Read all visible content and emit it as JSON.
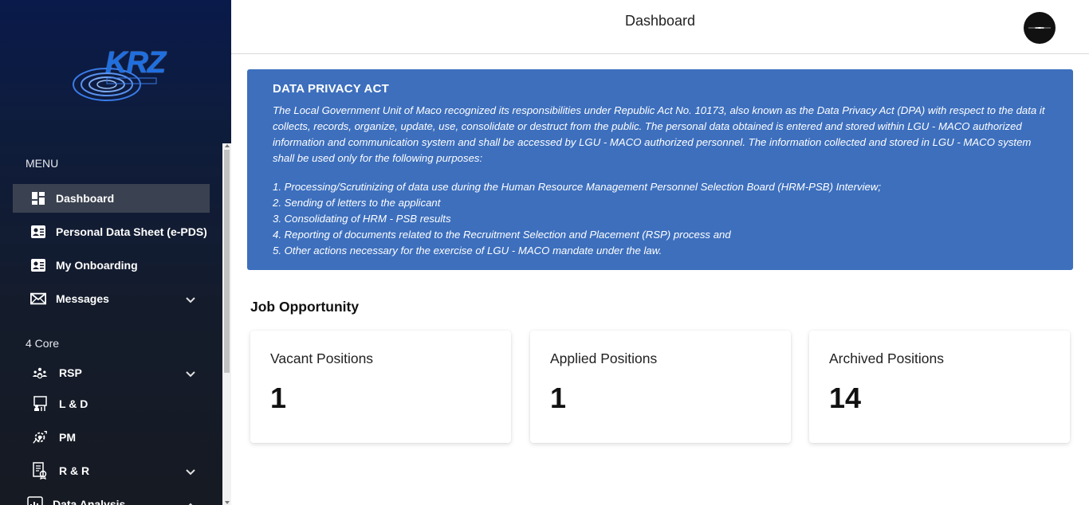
{
  "sidebar": {
    "logo_text": "KRZ",
    "menu_label": "MENU",
    "menu": [
      {
        "label": "Dashboard",
        "icon": "dashboard-grid-icon"
      },
      {
        "label": "Personal Data Sheet (e-PDS)",
        "icon": "id-card-icon"
      },
      {
        "label": "My Onboarding",
        "icon": "id-card-icon"
      },
      {
        "label": "Messages",
        "icon": "envelope-icon"
      }
    ],
    "core_label": "4 Core",
    "core": [
      {
        "label": "RSP",
        "icon": "people-network-icon"
      },
      {
        "label": "L & D",
        "icon": "training-board-icon"
      },
      {
        "label": "PM",
        "icon": "performance-gear-icon"
      },
      {
        "label": "R & R",
        "icon": "award-document-icon"
      },
      {
        "label": "Data Analysis",
        "icon": "chart-icon"
      }
    ]
  },
  "header": {
    "title": "Dashboard"
  },
  "privacy": {
    "title": "DATA PRIVACY ACT",
    "body": "The Local Government Unit of Maco recognized its responsibilities under Republic Act No. 10173, also known as the Data Privacy Act (DPA) with respect to the data it collects, records, organize, update, use, consolidate or destruct from the public. The personal data obtained is entered and stored within LGU - MACO authorized information and communication system and shall be accessed by LGU - MACO authorized personnel. The information collected and stored in LGU - MACO system shall be used only for the following purposes:",
    "items": [
      "1. Processing/Scrutinizing of data use during the Human Resource Management Personnel Selection Board (HRM-PSB) Interview;",
      "2. Sending of letters to the applicant",
      "3. Consolidating of HRM - PSB results",
      "4. Reporting of documents related to the Recruitment Selection and Placement (RSP) process and",
      "5. Other actions necessary for the exercise of LGU - MACO mandate under the law."
    ]
  },
  "jobs": {
    "title": "Job Opportunity",
    "cards": [
      {
        "label": "Vacant Positions",
        "value": "1"
      },
      {
        "label": "Applied Positions",
        "value": "1"
      },
      {
        "label": "Archived Positions",
        "value": "14"
      }
    ]
  },
  "colors": {
    "sidebar_top": "#0a1a4a",
    "sidebar_bottom": "#161a22",
    "active_item": "#3a4150",
    "privacy_bg": "#3d6fbd"
  }
}
